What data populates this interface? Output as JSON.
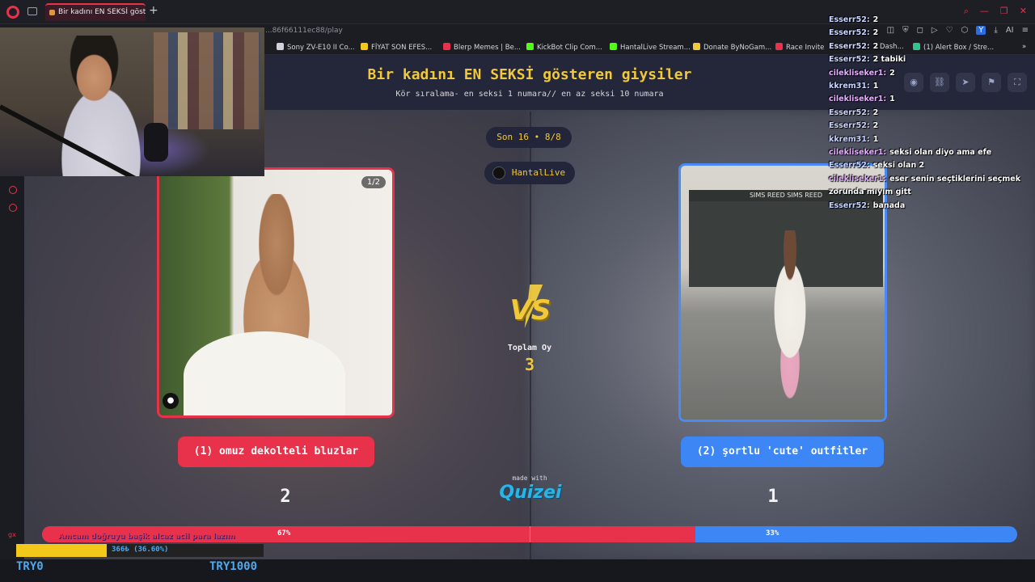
{
  "browser": {
    "tab_title": "Bir kadını EN SEKSİ göster",
    "url": "...86f66111ec88/play",
    "bookmarks": [
      {
        "label": "Sony ZV-E10 II Co...",
        "color": "#cfd2da"
      },
      {
        "label": "FİYAT SON EFES...",
        "color": "#f2c81a"
      },
      {
        "label": "Blerp Memes | Be...",
        "color": "#e8314a"
      },
      {
        "label": "KickBot Clip Com...",
        "color": "#53fc18"
      },
      {
        "label": "HantalLive Stream...",
        "color": "#53fc18"
      },
      {
        "label": "Donate ByNoGam...",
        "color": "#f0c83a"
      },
      {
        "label": "Race Invite",
        "color": "#e8314a"
      },
      {
        "label": "Dash...",
        "color": "#4ea8ef"
      },
      {
        "label": "(1) Alert Box / Stre...",
        "color": "#31c48d"
      }
    ],
    "ext_y": "Y",
    "ext_ai": "AI"
  },
  "page": {
    "title": "Bir kadını EN SEKSİ gösteren giysiler",
    "subtitle": "Kör sıralama- en seksi 1 numara// en az seksi 10 numara",
    "round": "Son 16 • 8/8",
    "channel": "HantalLive",
    "vs": "VS",
    "total_label": "Toplam Oy",
    "total_value": "3",
    "image_count": "1/2",
    "left_option": "(1) omuz dekolteli bluzlar",
    "right_option": "(2) şortlu 'cute' outfitler",
    "left_votes": "2",
    "right_votes": "1",
    "made_with": "made with",
    "brand": "Quizei",
    "left_percent_label": "67%",
    "right_percent_label": "33%",
    "left_percent": 0.67,
    "shop_sign": "SIMS REED        SIMS REED"
  },
  "chat": [
    {
      "user": "Esserr52:",
      "msg": "2",
      "color": "#c8d4ff"
    },
    {
      "user": "Esserr52:",
      "msg": "2",
      "color": "#c8d4ff"
    },
    {
      "user": "Esserr52:",
      "msg": "2",
      "color": "#c8d4ff"
    },
    {
      "user": "Esserr52:",
      "msg": "2 tabiki",
      "color": "#c8d4ff"
    },
    {
      "user": "cilekliseker1:",
      "msg": "2",
      "color": "#e3b0ff"
    },
    {
      "user": "kkrem31:",
      "msg": "1",
      "color": "#c8d4ff"
    },
    {
      "user": "cilekliseker1:",
      "msg": "1",
      "color": "#e3b0ff"
    },
    {
      "user": "Esserr52:",
      "msg": "2",
      "color": "#c8d4ff"
    },
    {
      "user": "Esserr52:",
      "msg": "2",
      "color": "#c8d4ff"
    },
    {
      "user": "kkrem31:",
      "msg": "1",
      "color": "#c8d4ff"
    },
    {
      "user": "cilekliseker1:",
      "msg": "seksi olan diyo ama efe",
      "color": "#e3b0ff"
    },
    {
      "user": "Esserr52:",
      "msg": "seksi olan 2",
      "color": "#c8d4ff"
    },
    {
      "user": "cilekliseker1:",
      "msg": "eser senin seçtiklerini seçmek",
      "color": "#e3b0ff"
    },
    {
      "user": "",
      "msg": "zorunda mıyım gitt",
      "color": "#c8d4ff"
    },
    {
      "user": "Esserr52:",
      "msg": "banada",
      "color": "#c8d4ff"
    }
  ],
  "stream": {
    "donate_msg": "Amcam doğruyu başik alcaz acil para lazım",
    "goal_text": "366₺ (36.60%)",
    "goal_fraction": 0.366,
    "try_left": "TRY0",
    "try_right": "TRY1000",
    "gx": "gx"
  }
}
